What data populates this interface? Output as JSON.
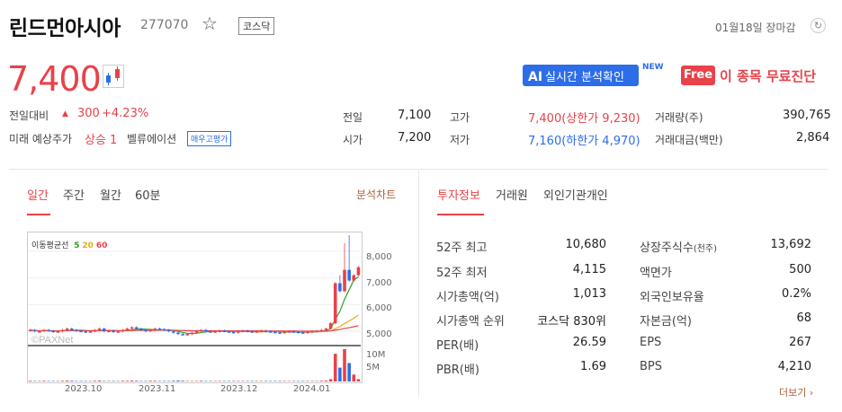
{
  "header": {
    "stock_name": "린드먼아시아",
    "stock_code": "277070",
    "market": "코스닥",
    "date_status": "01월18일 장마감",
    "ai_button_prefix": "AI",
    "ai_button_label": "실시간 분석확인",
    "new_badge": "NEW",
    "free_badge": "Free",
    "free_label": "이 종목 무료진단"
  },
  "price": {
    "current": "7,400",
    "change_label": "전일대비",
    "change_value": "300",
    "change_pct": "+4.23%",
    "forecast_label": "미래 예상주가",
    "forecast_value": "상승 1",
    "valuation_label": "벨류에이션",
    "valuation_badge": "매우고평가"
  },
  "quote": {
    "prev_close_label": "전일",
    "prev_close": "7,100",
    "open_label": "시가",
    "open": "7,200",
    "high_label": "고가",
    "high": "7,400(상한가 9,230)",
    "low_label": "저가",
    "low": "7,160(하한가 4,970)",
    "volume_label": "거래량(주)",
    "volume": "390,765",
    "amount_label": "거래대금(백만)",
    "amount": "2,864"
  },
  "chart_tabs": [
    "일간",
    "주간",
    "월간",
    "60분"
  ],
  "chart_link": "분석차트",
  "info_tabs": [
    "투자정보",
    "거래원",
    "외인기관개인"
  ],
  "chart_data": {
    "type": "candlestick",
    "legend_label": "이동평균선",
    "ma_periods": [
      "5",
      "20",
      "60"
    ],
    "ma_colors": [
      "#2ca02c",
      "#e6a817",
      "#e8424a"
    ],
    "watermark": "©PAXNet",
    "y_ticks": [
      "8,000",
      "7,000",
      "6,000",
      "5,000"
    ],
    "y_range": [
      4600,
      8700
    ],
    "volume_ticks": [
      "10M",
      "5M"
    ],
    "x_ticks": [
      "2023.10",
      "2023.11",
      "2023.12",
      "2024.01"
    ],
    "closes": [
      5050,
      5000,
      5000,
      5050,
      5020,
      4980,
      5000,
      5050,
      5100,
      5050,
      5020,
      5000,
      4980,
      5000,
      5050,
      5100,
      5000,
      5020,
      4980,
      5000,
      5050,
      5100,
      5150,
      5100,
      5050,
      5000,
      5050,
      5100,
      5080,
      5050,
      5000,
      4950,
      4900,
      4880,
      4900,
      4950,
      5000,
      5050,
      5000,
      4980,
      5000,
      5020,
      5000,
      4980,
      4950,
      5000,
      5020,
      5000,
      4980,
      5000,
      5020,
      5000,
      4980,
      4960,
      4950,
      4980,
      5000,
      4980,
      4960,
      4950,
      4980,
      5000,
      5020,
      5050,
      5100,
      5300,
      6800,
      6500,
      7300,
      6900,
      7100,
      7400
    ],
    "highs_spike": [
      [
        67,
        7100
      ],
      [
        68,
        8300
      ],
      [
        69,
        8600
      ]
    ],
    "volumes_M": [
      0.3,
      0.2,
      0.2,
      0.3,
      0.2,
      0.2,
      0.2,
      0.3,
      0.4,
      0.3,
      0.2,
      0.2,
      0.2,
      0.2,
      0.3,
      0.4,
      0.2,
      0.2,
      0.2,
      0.2,
      0.3,
      0.3,
      0.4,
      0.3,
      0.2,
      0.2,
      0.3,
      0.3,
      0.2,
      0.2,
      0.2,
      0.3,
      0.4,
      0.3,
      0.2,
      0.2,
      0.2,
      0.3,
      0.2,
      0.2,
      0.2,
      0.2,
      0.2,
      0.2,
      0.2,
      0.2,
      0.2,
      0.2,
      0.2,
      0.2,
      0.2,
      0.2,
      0.2,
      0.2,
      0.2,
      0.2,
      0.2,
      0.2,
      0.2,
      0.2,
      0.2,
      0.2,
      0.2,
      0.3,
      0.4,
      1.0,
      12.0,
      6.0,
      14.0,
      8.0,
      3.0,
      1.0
    ]
  },
  "invest_left": [
    {
      "label": "52주 최고",
      "value": "10,680"
    },
    {
      "label": "52주 최저",
      "value": "4,115"
    },
    {
      "label": "시가총액(억)",
      "value": "1,013"
    },
    {
      "label": "시가총액 순위",
      "value": "코스닥 830위"
    },
    {
      "label": "PER(배)",
      "value": "26.59"
    },
    {
      "label": "PBR(배)",
      "value": "1.69"
    }
  ],
  "invest_right": [
    {
      "label": "상장주식수",
      "sub": "(천주)",
      "value": "13,692"
    },
    {
      "label": "액면가",
      "sub": "",
      "value": "500"
    },
    {
      "label": "외국인보유율",
      "sub": "",
      "value": "0.2%"
    },
    {
      "label": "자본금(억)",
      "sub": "",
      "value": "68"
    },
    {
      "label": "EPS",
      "sub": "",
      "value": "267"
    },
    {
      "label": "BPS",
      "sub": "",
      "value": "4,210"
    }
  ],
  "more_link": "더보기 ›"
}
